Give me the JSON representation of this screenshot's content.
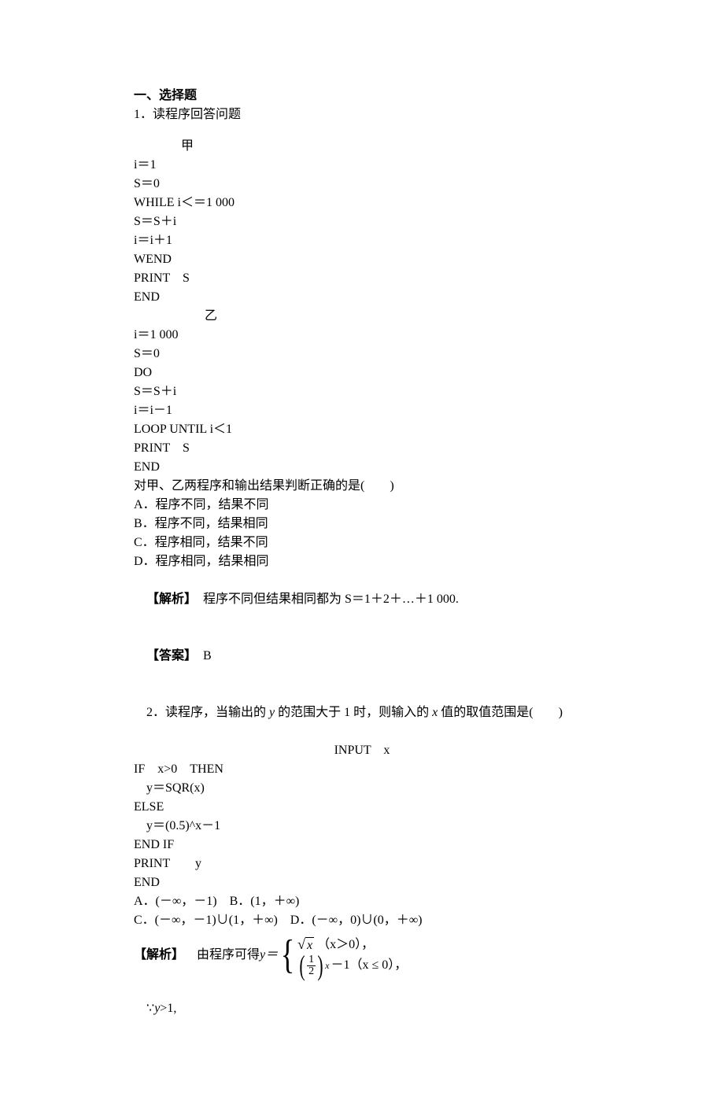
{
  "section_heading": "一、选择题",
  "q1": {
    "stem": "1．读程序回答问题",
    "label_a": "甲",
    "prog_a": [
      "i＝1",
      "S＝0",
      "WHILE i＜＝1 000",
      "S＝S＋i",
      "i＝i＋1",
      "WEND",
      "PRINT　S",
      "END"
    ],
    "label_b": "乙",
    "prog_b": [
      "i＝1 000",
      "S＝0",
      "DO",
      "S＝S＋i",
      "i＝i－1",
      "LOOP UNTIL i＜1",
      "PRINT　S",
      "END"
    ],
    "question_tail": "对甲、乙两程序和输出结果判断正确的是(　　)",
    "options": [
      "A．程序不同，结果不同",
      "B．程序不同，结果相同",
      "C．程序相同，结果不同",
      "D．程序相同，结果相同"
    ],
    "analysis_label": "【解析】",
    "analysis_text": "　程序不同但结果相同都为 S＝1＋2＋…＋1 000.",
    "answer_label": "【答案】",
    "answer_text": "　B"
  },
  "q2": {
    "stem_prefix": "2．读程序，当输出的 ",
    "stem_mid1": " 的范围大于 1 时，则输入的 ",
    "stem_mid2": " 值的取值范围是(　　)",
    "input_line": "INPUT　x",
    "prog": [
      "IF　x>0　THEN",
      "　y＝SQR(x)",
      "ELSE",
      "　y＝(0.5)^x－1",
      "END IF",
      "PRINT　　y",
      "END"
    ],
    "opt_ab": "A．(－∞，－1)　B．(1，＋∞)",
    "opt_cd": "C．(－∞，－1)∪(1，＋∞)　D．(－∞，0)∪(0，＋∞)",
    "analysis_label": "【解析】",
    "analysis_prefix": "　由程序可得 ",
    "y_eq": "y＝",
    "piece1_cond": "（x＞0），",
    "piece2_tail": "－1（x ≤ 0），",
    "since": "∵y>1,"
  },
  "vars": {
    "y": "y",
    "x": "x",
    "S": "S"
  }
}
